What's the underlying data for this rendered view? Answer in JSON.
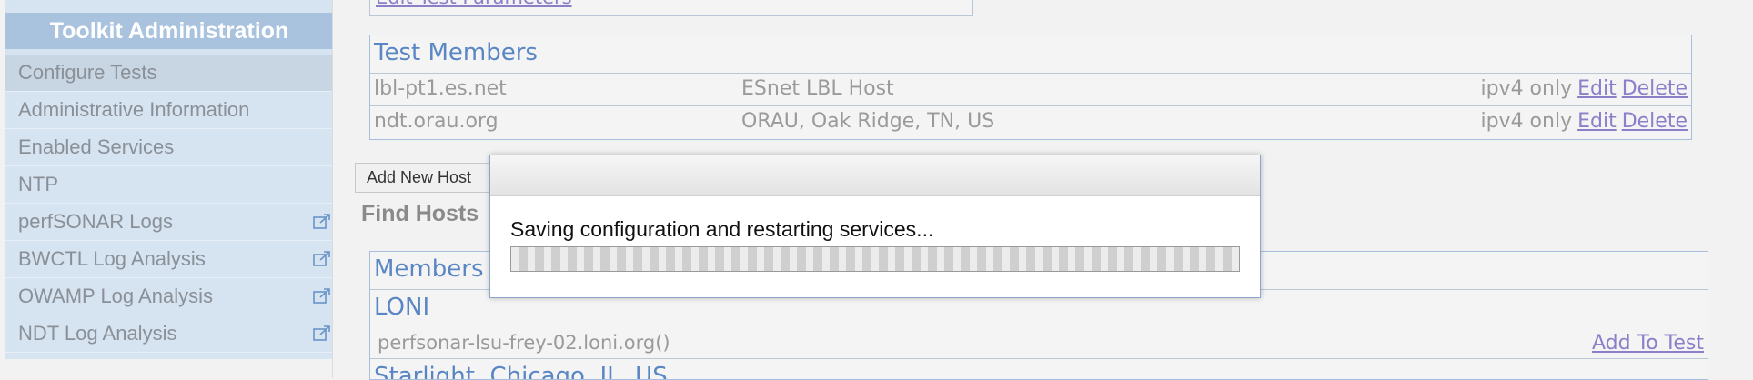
{
  "sidebar": {
    "header": "Toolkit Administration",
    "items": [
      {
        "label": "Configure Tests",
        "active": true,
        "external": false
      },
      {
        "label": "Administrative Information",
        "active": false,
        "external": false
      },
      {
        "label": "Enabled Services",
        "active": false,
        "external": false
      },
      {
        "label": "NTP",
        "active": false,
        "external": false
      },
      {
        "label": "perfSONAR Logs",
        "active": false,
        "external": true
      },
      {
        "label": "BWCTL Log Analysis",
        "active": false,
        "external": true
      },
      {
        "label": "OWAMP Log Analysis",
        "active": false,
        "external": true
      },
      {
        "label": "NDT Log Analysis",
        "active": false,
        "external": true
      }
    ]
  },
  "main": {
    "edit_params_link": "Edit Test Parameters",
    "test_members": {
      "title": "Test Members",
      "rows": [
        {
          "host": "lbl-pt1.es.net",
          "description": "ESnet LBL Host",
          "mode": "ipv4 only",
          "edit": "Edit",
          "delete": "Delete"
        },
        {
          "host": "ndt.orau.org",
          "description": "ORAU, Oak Ridge, TN, US",
          "mode": "ipv4 only",
          "edit": "Edit",
          "delete": "Delete"
        }
      ]
    },
    "add_new_host_button": "Add New Host",
    "find_hosts_heading": "Find Hosts",
    "members_box": {
      "title": "Members",
      "groups": [
        {
          "name": "LONI",
          "host": "perfsonar-lsu-frey-02.loni.org()",
          "action": "Add To Test"
        },
        {
          "name": "Starlight, Chicago, IL, US"
        }
      ]
    }
  },
  "modal": {
    "message": "Saving configuration and restarting services..."
  },
  "colors": {
    "sidebar_bg": "#d6e3f0",
    "sidebar_header_bg": "#a9c2de",
    "heading_blue": "#5a86c4",
    "link_purple": "#8b7fc8"
  }
}
